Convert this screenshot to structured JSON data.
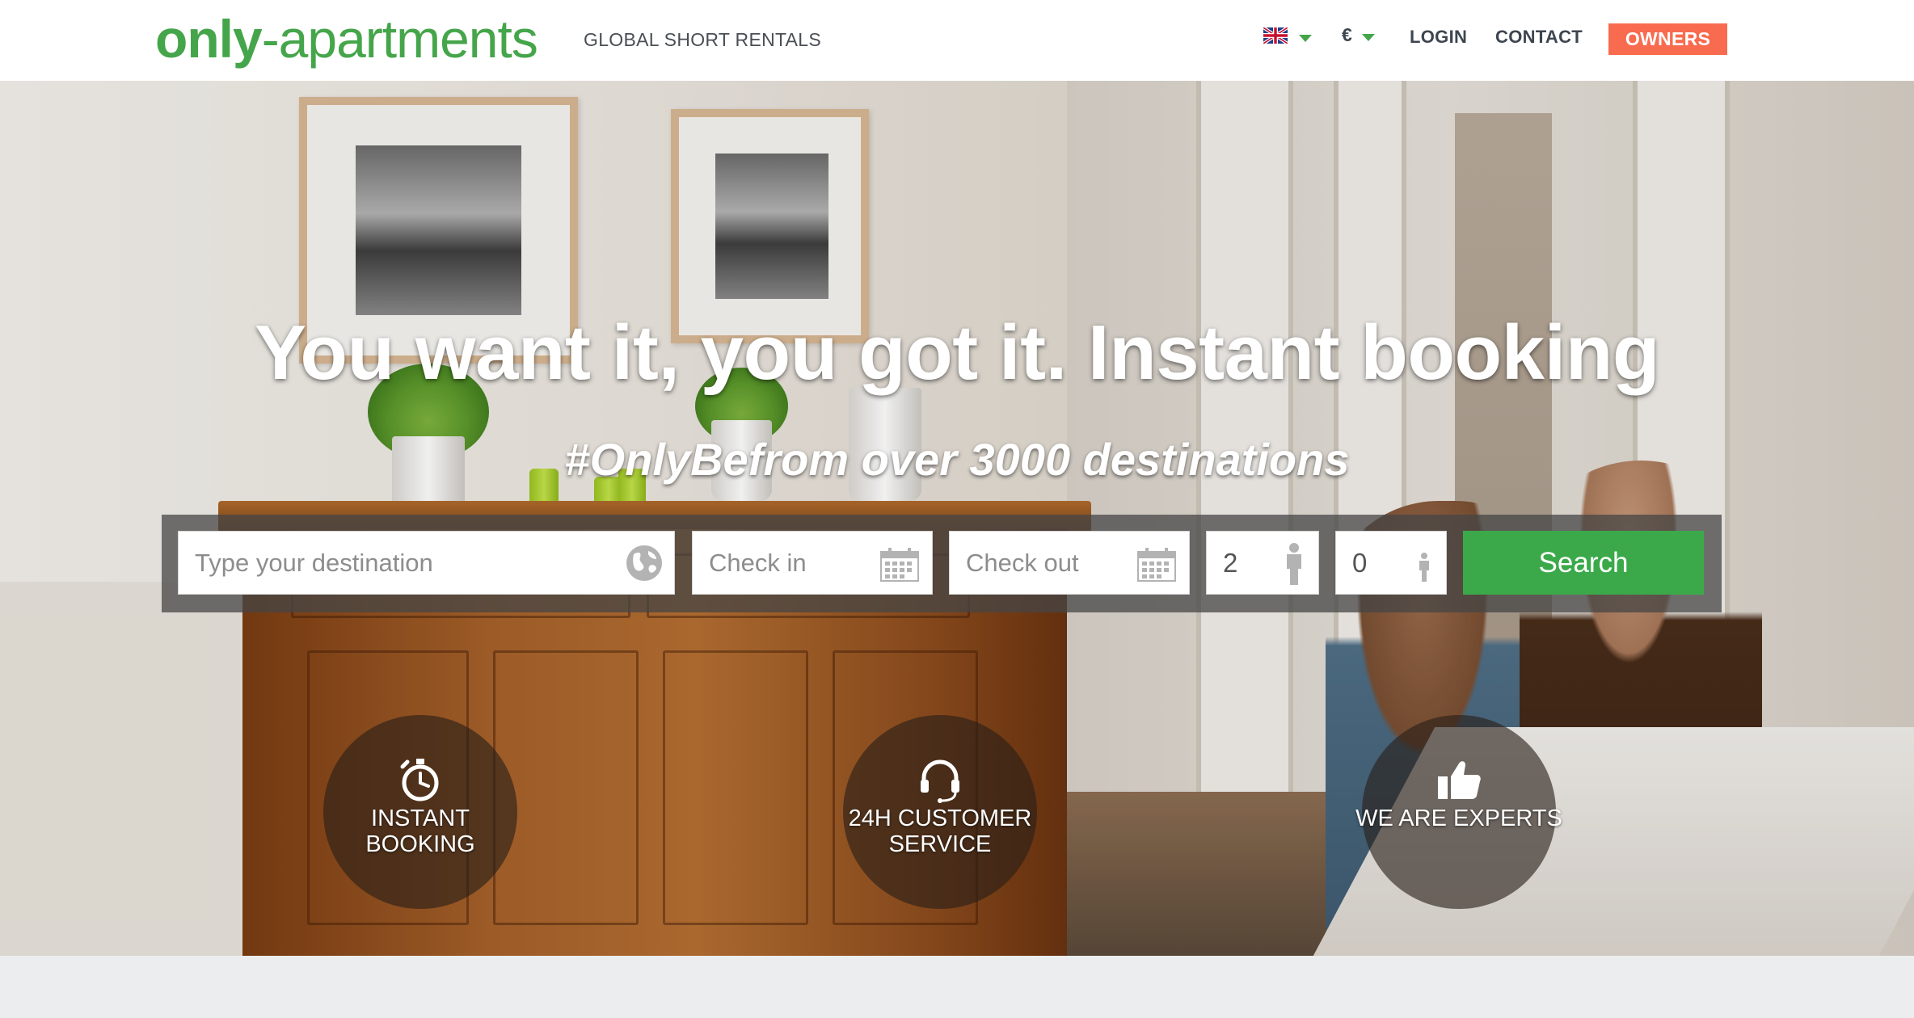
{
  "header": {
    "logo_bold": "only",
    "logo_rest": "-apartments",
    "tagline": "GLOBAL SHORT RENTALS",
    "currency": "€",
    "nav": {
      "login": "LOGIN",
      "contact": "CONTACT",
      "owners": "OWNERS"
    }
  },
  "hero": {
    "headline": "You want it, you got it. Instant booking",
    "subline": "#OnlyBefrom over 3000 destinations"
  },
  "search": {
    "destination_placeholder": "Type your destination",
    "checkin_placeholder": "Check in",
    "checkout_placeholder": "Check out",
    "adults": "2",
    "children": "0",
    "button": "Search"
  },
  "features": [
    {
      "line1": "INSTANT",
      "line2": "BOOKING",
      "icon": "stopwatch-icon"
    },
    {
      "line1": "24H CUSTOMER",
      "line2": "SERVICE",
      "icon": "headset-icon"
    },
    {
      "line1": "WE ARE EXPERTS",
      "line2": "",
      "icon": "thumbs-up-icon"
    }
  ],
  "colors": {
    "brand_green": "#45a54a",
    "owners_orange": "#f86b4f",
    "search_green": "#3ba94a",
    "nav_text": "#3d4650"
  }
}
